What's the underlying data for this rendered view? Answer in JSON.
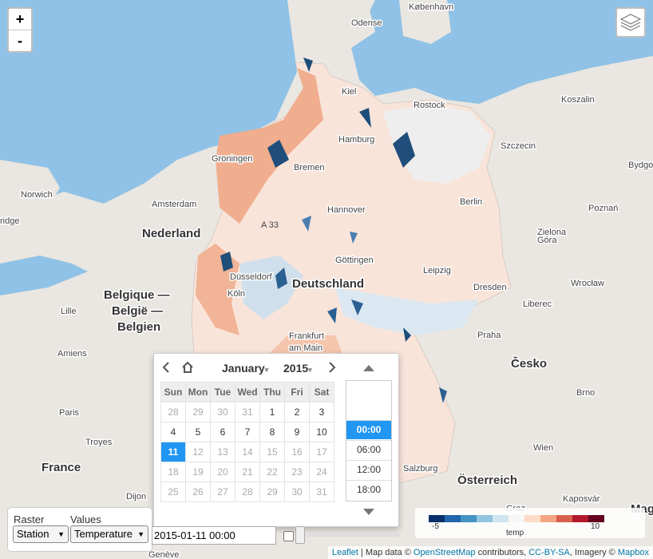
{
  "map": {
    "zoom_in_label": "+",
    "zoom_out_label": "-",
    "labels": {
      "copenhagen": "København",
      "odense": "Odense",
      "kiel": "Kiel",
      "rostock": "Rostock",
      "koszalin": "Koszalin",
      "hamburg": "Hamburg",
      "szczecin": "Szczecin",
      "groningen": "Groningen",
      "bremen": "Bremen",
      "bydgoszcz": "Bydgos",
      "norwich": "Norwich",
      "amsterdam": "Amsterdam",
      "berlin": "Berlin",
      "poznan": "Poznań",
      "cambridge": "ridge",
      "hannover": "Hannover",
      "a33": "A 33",
      "nederland": "Nederland",
      "zielona": "Zielona",
      "gora": "Góra",
      "gottingen": "Göttingen",
      "dusseldorf": "Düsseldorf",
      "leipzig": "Leipzig",
      "deutschland": "Deutschland",
      "dresden": "Dresden",
      "wroclaw": "Wrocław",
      "koln": "Köln",
      "liberec": "Liberec",
      "belgique1": "Belgique —",
      "belgique2": "België —",
      "belgique3": "Belgien",
      "lille": "Lille",
      "frankfurt1": "Frankfurt",
      "frankfurt2": "am Main",
      "praha": "Praha",
      "amiens": "Amiens",
      "cesko": "Česko",
      "paris": "Paris",
      "brno": "Brno",
      "troyes": "Troyes",
      "france": "France",
      "wien": "Wien",
      "salzburg": "Salzburg",
      "osterreich": "Österreich",
      "dijon": "Dijon",
      "graz": "Graz",
      "kaposvar": "Kaposvár",
      "geneve": "Genève",
      "mag": "Mag"
    }
  },
  "datepicker": {
    "month": "January",
    "year": "2015",
    "weekdays": [
      "Sun",
      "Mon",
      "Tue",
      "Wed",
      "Thu",
      "Fri",
      "Sat"
    ],
    "weeks": [
      [
        "28",
        "29",
        "30",
        "31",
        "1",
        "2",
        "3"
      ],
      [
        "4",
        "5",
        "6",
        "7",
        "8",
        "9",
        "10"
      ],
      [
        "11",
        "12",
        "13",
        "14",
        "15",
        "16",
        "17"
      ],
      [
        "18",
        "19",
        "20",
        "21",
        "22",
        "23",
        "24"
      ],
      [
        "25",
        "26",
        "27",
        "28",
        "29",
        "30",
        "31"
      ]
    ],
    "selected_day": "11",
    "times": [
      "00:00",
      "06:00",
      "12:00",
      "18:00"
    ],
    "selected_time": "00:00"
  },
  "controls": {
    "raster_label": "Raster",
    "raster_value": "Station",
    "values_label": "Values",
    "values_value": "Temperature",
    "datetime_value": "2015-01-11 00:00"
  },
  "legend": {
    "min_label": "-5",
    "mid_label": "temp",
    "max_label": "10",
    "colors": [
      "#08306b",
      "#2166ac",
      "#4393c3",
      "#92c5de",
      "#d1e5f0",
      "#f7f7f7",
      "#fddbc7",
      "#f4a582",
      "#d6604d",
      "#b2182b",
      "#67001f"
    ]
  },
  "attribution": {
    "leaflet": "Leaflet",
    "sep": " | Map data © ",
    "osm": "OpenStreetMap",
    "contrib": " contributors, ",
    "license": "CC-BY-SA",
    "imagery": ", Imagery © ",
    "mapbox": "Mapbox"
  }
}
